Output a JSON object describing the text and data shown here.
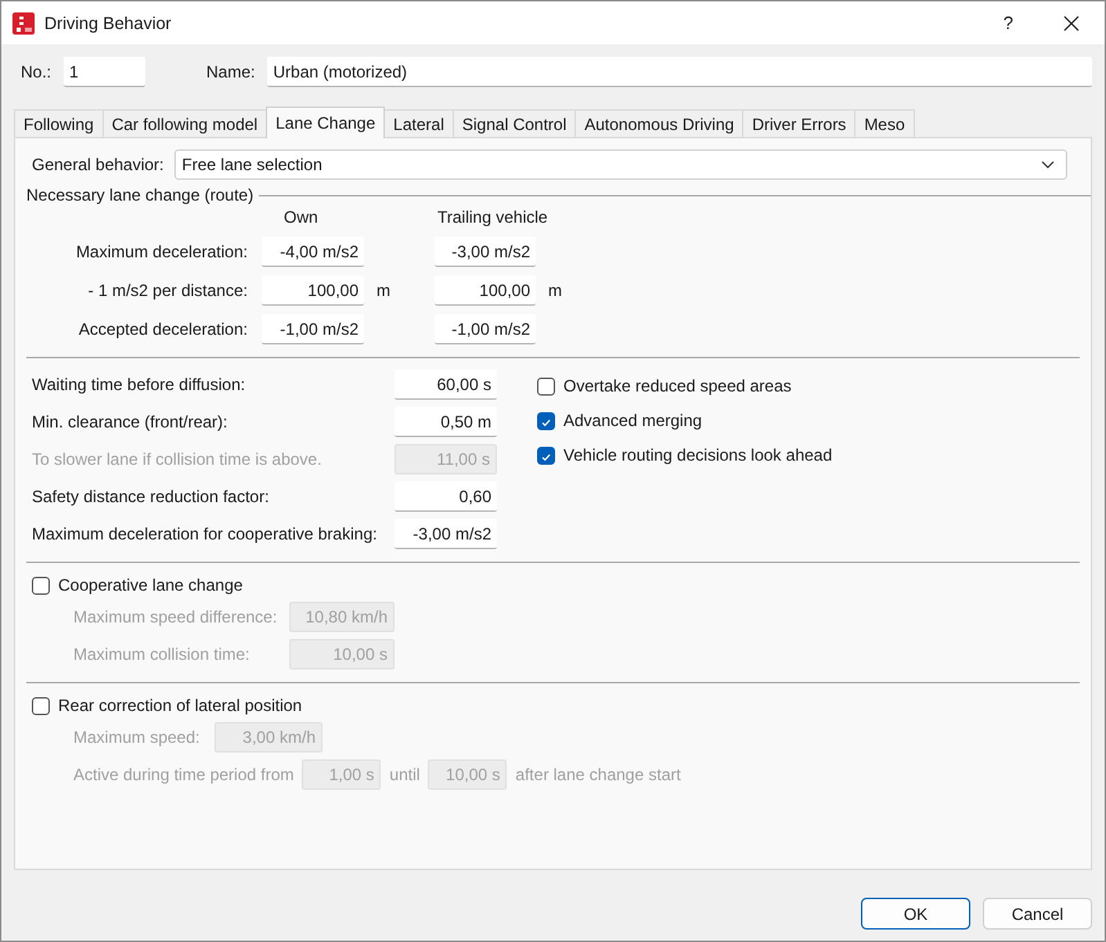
{
  "window": {
    "title": "Driving Behavior",
    "help": "?"
  },
  "header": {
    "number_label": "No.:",
    "number": "1",
    "name_label": "Name:",
    "name": "Urban (motorized)"
  },
  "tabs": [
    {
      "label": "Following",
      "selected": false
    },
    {
      "label": "Car following model",
      "selected": false
    },
    {
      "label": "Lane Change",
      "selected": true
    },
    {
      "label": "Lateral",
      "selected": false
    },
    {
      "label": "Signal Control",
      "selected": false
    },
    {
      "label": "Autonomous Driving",
      "selected": false
    },
    {
      "label": "Driver Errors",
      "selected": false
    },
    {
      "label": "Meso",
      "selected": false
    }
  ],
  "general_behavior": {
    "label": "General behavior:",
    "value": "Free lane selection"
  },
  "necessary_lane_change": {
    "title": "Necessary lane change (route)",
    "columns": [
      "Own",
      "Trailing vehicle"
    ],
    "rows": [
      {
        "label": "Maximum deceleration:",
        "own": "-4,00 m/s2",
        "trailing": "-3,00 m/s2"
      },
      {
        "label": "- 1 m/s2 per distance:",
        "own": "100,00",
        "own_unit": "m",
        "trailing": "100,00",
        "trailing_unit": "m"
      },
      {
        "label": "Accepted deceleration:",
        "own": "-1,00 m/s2",
        "trailing": "-1,00 m/s2"
      }
    ]
  },
  "parameters": [
    {
      "label": "Waiting time before diffusion:",
      "value": "60,00 s",
      "disabled": false
    },
    {
      "label": "Min. clearance (front/rear):",
      "value": "0,50 m",
      "disabled": false
    },
    {
      "label": "To slower lane if collision time is above.",
      "value": "11,00 s",
      "disabled": true
    },
    {
      "label": "Safety distance reduction factor:",
      "value": "0,60",
      "disabled": false
    },
    {
      "label": "Maximum deceleration for cooperative braking:",
      "value": "-3,00 m/s2",
      "disabled": false
    }
  ],
  "options": [
    {
      "label": "Overtake reduced speed areas",
      "checked": false
    },
    {
      "label": "Advanced merging",
      "checked": true
    },
    {
      "label": "Vehicle routing decisions look ahead",
      "checked": true
    }
  ],
  "cooperative": {
    "label": "Cooperative lane change",
    "checked": false,
    "fields": [
      {
        "label": "Maximum speed difference:",
        "value": "10,80 km/h"
      },
      {
        "label": "Maximum collision time:",
        "value": "10,00 s"
      }
    ]
  },
  "rear_correction": {
    "label": "Rear correction of lateral position",
    "checked": false,
    "max_speed": {
      "label": "Maximum speed:",
      "value": "3,00 km/h"
    },
    "period": {
      "label": "Active during time period from",
      "from": "1,00 s",
      "until_label": "until",
      "until": "10,00 s",
      "after_label": "after lane change start"
    }
  },
  "buttons": [
    {
      "label": "OK",
      "default": true
    },
    {
      "label": "Cancel",
      "default": false
    }
  ]
}
